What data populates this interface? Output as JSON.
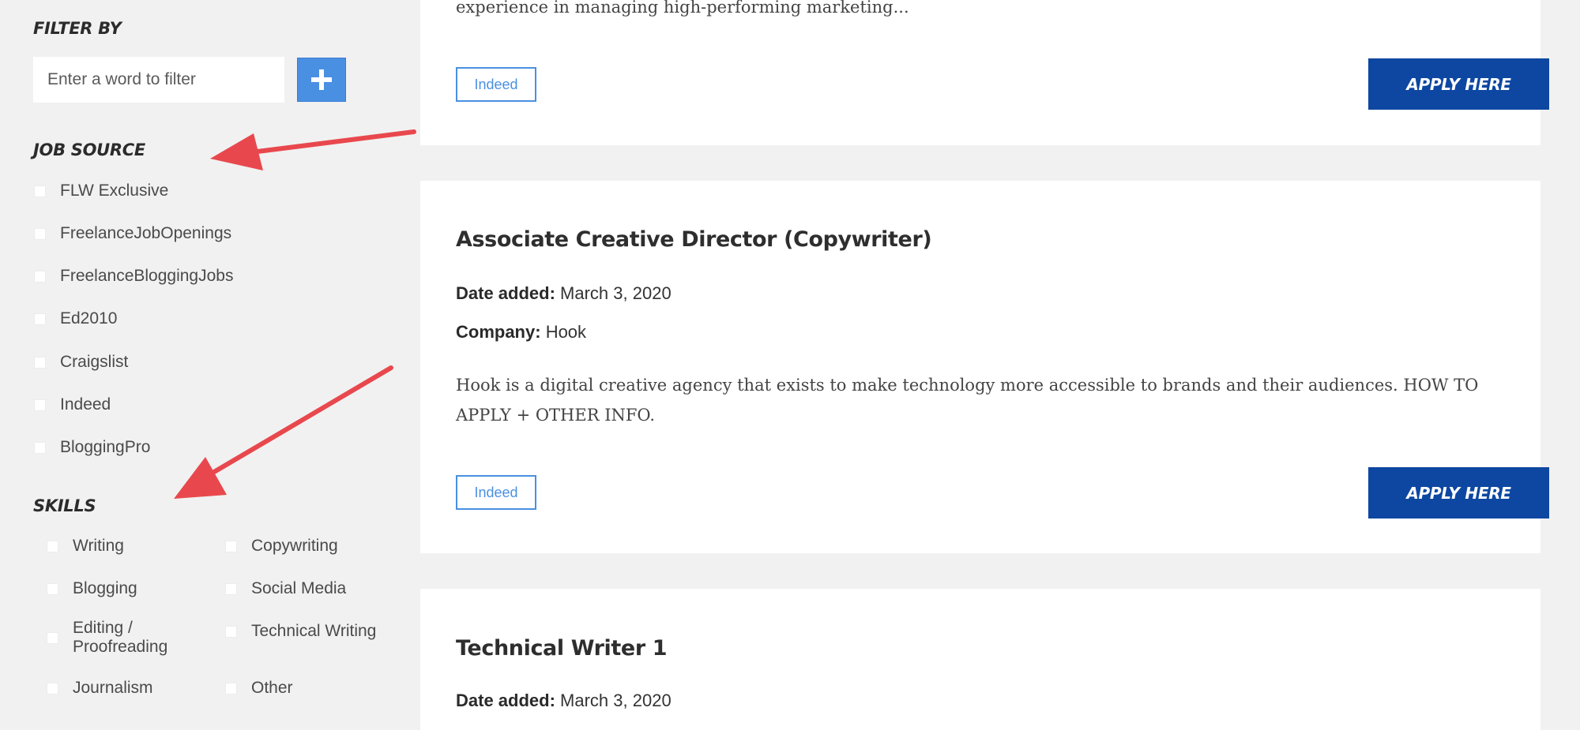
{
  "filter": {
    "heading": "FILTER BY",
    "placeholder": "Enter a word to filter",
    "add_icon": "plus-icon"
  },
  "job_source": {
    "heading": "JOB SOURCE",
    "items": [
      "FLW Exclusive",
      "FreelanceJobOpenings",
      "FreelanceBloggingJobs",
      "Ed2010",
      "Craigslist",
      "Indeed",
      "BloggingPro"
    ]
  },
  "skills": {
    "heading": "SKILLS",
    "items": [
      "Writing",
      "Copywriting",
      "Blogging",
      "Social Media",
      "Editing / Proofreading",
      "Technical Writing",
      "Journalism",
      "Other"
    ]
  },
  "jobs": [
    {
      "description": "experience in managing high-performing marketing...",
      "source": "Indeed",
      "apply_label": "APPLY HERE"
    },
    {
      "title": "Associate Creative Director (Copywriter)",
      "date_label": "Date added:",
      "date": "March 3, 2020",
      "company_label": "Company:",
      "company": "Hook",
      "description": "Hook is a digital creative agency that exists to make technology more accessible to brands and their audiences. HOW TO APPLY + OTHER INFO.",
      "source": "Indeed",
      "apply_label": "APPLY HERE"
    },
    {
      "title": "Technical Writer 1",
      "date_label": "Date added:",
      "date": "March 3, 2020"
    }
  ],
  "colors": {
    "background": "#f1f1f1",
    "accent_blue": "#4a90e2",
    "apply_button": "#0d47a1",
    "annotation_arrow": "#e8484d"
  }
}
